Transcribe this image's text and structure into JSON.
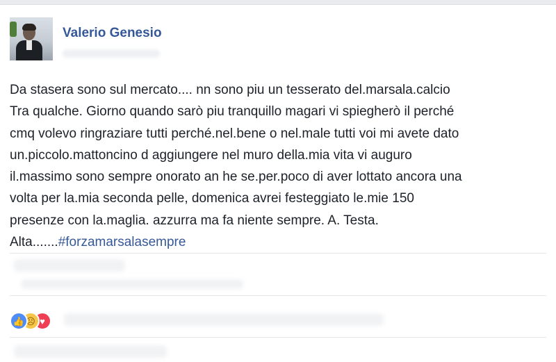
{
  "post": {
    "author": "Valerio Genesio",
    "body_lines": [
      "Da stasera sono sul mercato.... nn sono piu un tesserato del.marsala.calcio",
      "Tra qualche. Giorno quando sarò piu tranquillo magari vi spiegherò il perché",
      "cmq volevo ringraziare tutti perché.nel.bene o nel.male tutti voi mi avete dato",
      "un.piccolo.mattoncino d aggiungere nel muro della.mia vita vi auguro",
      "il.massimo sono sempre onorato an he se.per.poco di aver lottato ancora una",
      "volta per la.mia seconda pelle, domenica avrei festeggiato le.mie 150",
      "presenze con la.maglia. azzurra ma fa niente sempre. A. Testa.",
      "Alta......."
    ],
    "hashtag": "#forzamarsalasempre"
  },
  "reactions": {
    "icons": [
      "like-icon",
      "sad-icon",
      "love-icon"
    ],
    "colors": {
      "like": "#4e8cf6",
      "sad": "#f6c64a",
      "love": "#ee3f55"
    }
  },
  "theme": {
    "link_color": "#365899",
    "text_color": "#1d2129",
    "background": "#e9ebee"
  }
}
